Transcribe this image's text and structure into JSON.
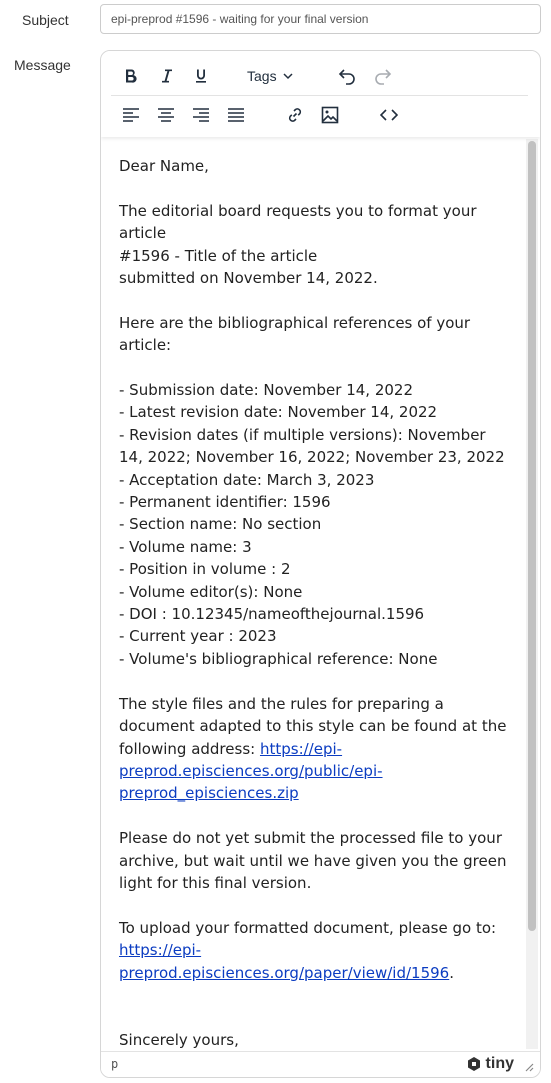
{
  "form": {
    "subject_label": "Subject",
    "subject_value": "epi-preprod #1596 - waiting for your final version",
    "message_label": "Message"
  },
  "toolbar": {
    "bold_icon": "bold-icon",
    "italic_icon": "italic-icon",
    "underline_icon": "underline-icon",
    "tags_label": "Tags",
    "undo_icon": "undo-icon",
    "redo_icon": "redo-icon",
    "align_left_icon": "align-left-icon",
    "align_center_icon": "align-center-icon",
    "align_right_icon": "align-right-icon",
    "justify_icon": "align-justify-icon",
    "link_icon": "link-icon",
    "image_icon": "image-icon",
    "code_icon": "source-code-icon"
  },
  "message": {
    "greeting": "Dear Name,",
    "intro_1": "The editorial board requests you to format your article",
    "intro_2": "#1596 - Title of the article",
    "intro_3": "submitted on November 14, 2022.",
    "refs_intro": "Here are the bibliographical references of your article:",
    "refs": [
      "- Submission date: November 14, 2022",
      "- Latest revision date: November 14, 2022",
      "- Revision dates (if multiple versions): November 14, 2022; November 16, 2022; November 23, 2022",
      "- Acceptation date: March 3, 2023",
      "- Permanent identifier: 1596",
      "- Section name: No section",
      "- Volume name: 3",
      "- Position in volume : 2",
      "- Volume editor(s): None",
      "- DOI : 10.12345/nameofthejournal.1596",
      "- Current year : 2023",
      "- Volume's bibliographical reference: None"
    ],
    "style_text": "The style files and the rules for preparing a document adapted to this style can be found at the following address: ",
    "style_link": "https://epi-preprod.episciences.org/public/epi-preprod_episciences.zip",
    "wait_text": "Please do not yet submit the processed file to your archive, but wait until we have given you the green light for this final version.",
    "upload_text": "To upload your formatted document, please go to:",
    "upload_link": "https://epi-preprod.episciences.org/paper/view/id/1596",
    "upload_suffix": ".",
    "closing": "Sincerely yours,"
  },
  "statusbar": {
    "path": "p",
    "brand": "tiny"
  },
  "colors": {
    "link": "#0b3cc1",
    "toolbar_icon": "#222f3e",
    "disabled_icon": "#a8acb1"
  }
}
